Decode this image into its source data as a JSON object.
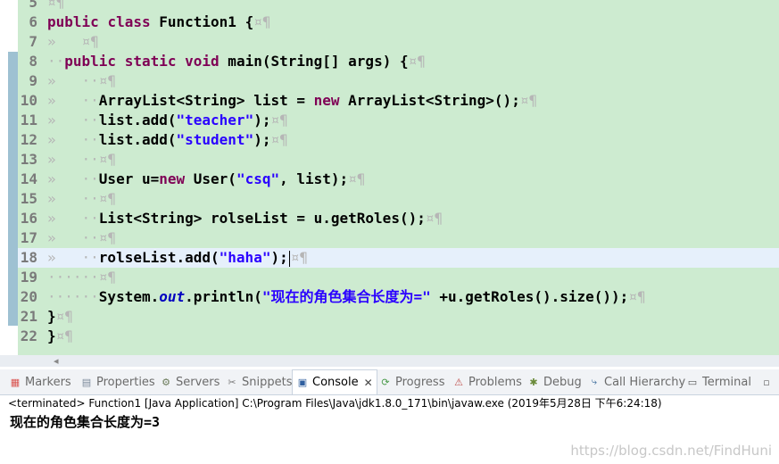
{
  "editor": {
    "lines": [
      {
        "num": "5",
        "segments": [
          {
            "t": "¤¶",
            "c": "ws"
          }
        ]
      },
      {
        "num": "6",
        "segments": [
          {
            "t": "public",
            "c": "kw"
          },
          {
            "t": " "
          },
          {
            "t": "class",
            "c": "kw"
          },
          {
            "t": " Function1 {"
          },
          {
            "t": "¤¶",
            "c": "ws"
          }
        ]
      },
      {
        "num": "7",
        "segments": [
          {
            "t": "»   ",
            "c": "ws"
          },
          {
            "t": "¤¶",
            "c": "ws"
          }
        ]
      },
      {
        "num": "8",
        "segments": [
          {
            "t": "··",
            "c": "ws"
          },
          {
            "t": "public",
            "c": "kw"
          },
          {
            "t": " "
          },
          {
            "t": "static",
            "c": "kw"
          },
          {
            "t": " "
          },
          {
            "t": "void",
            "c": "kw"
          },
          {
            "t": " main(String[] args) {"
          },
          {
            "t": "¤¶",
            "c": "ws"
          }
        ]
      },
      {
        "num": "9",
        "segments": [
          {
            "t": "»   ··",
            "c": "ws"
          },
          {
            "t": "¤¶",
            "c": "ws"
          }
        ]
      },
      {
        "num": "10",
        "segments": [
          {
            "t": "»   ··",
            "c": "ws"
          },
          {
            "t": "ArrayList<String> list = "
          },
          {
            "t": "new",
            "c": "kw"
          },
          {
            "t": " ArrayList<String>();"
          },
          {
            "t": "¤¶",
            "c": "ws"
          }
        ]
      },
      {
        "num": "11",
        "segments": [
          {
            "t": "»   ··",
            "c": "ws"
          },
          {
            "t": "list.add("
          },
          {
            "t": "\"teacher\"",
            "c": "str"
          },
          {
            "t": ");"
          },
          {
            "t": "¤¶",
            "c": "ws"
          }
        ]
      },
      {
        "num": "12",
        "segments": [
          {
            "t": "»   ··",
            "c": "ws"
          },
          {
            "t": "list.add("
          },
          {
            "t": "\"student\"",
            "c": "str"
          },
          {
            "t": ");"
          },
          {
            "t": "¤¶",
            "c": "ws"
          }
        ]
      },
      {
        "num": "13",
        "segments": [
          {
            "t": "»   ··",
            "c": "ws"
          },
          {
            "t": "¤¶",
            "c": "ws"
          }
        ]
      },
      {
        "num": "14",
        "segments": [
          {
            "t": "»   ··",
            "c": "ws"
          },
          {
            "t": "User u="
          },
          {
            "t": "new",
            "c": "kw"
          },
          {
            "t": " User("
          },
          {
            "t": "\"csq\"",
            "c": "str"
          },
          {
            "t": ", list);"
          },
          {
            "t": "¤¶",
            "c": "ws"
          }
        ]
      },
      {
        "num": "15",
        "segments": [
          {
            "t": "»   ··",
            "c": "ws"
          },
          {
            "t": "¤¶",
            "c": "ws"
          }
        ]
      },
      {
        "num": "16",
        "segments": [
          {
            "t": "»   ··",
            "c": "ws"
          },
          {
            "t": "List<String> rolseList = u.getRoles();"
          },
          {
            "t": "¤¶",
            "c": "ws"
          }
        ]
      },
      {
        "num": "17",
        "segments": [
          {
            "t": "»   ··",
            "c": "ws"
          },
          {
            "t": "¤¶",
            "c": "ws"
          }
        ]
      },
      {
        "num": "18",
        "current": true,
        "segments": [
          {
            "t": "»   ··",
            "c": "ws"
          },
          {
            "t": "rolseList.add("
          },
          {
            "t": "\"haha\"",
            "c": "str"
          },
          {
            "t": ");"
          },
          {
            "t": "|",
            "c": "caret"
          },
          {
            "t": "¤¶",
            "c": "ws"
          }
        ]
      },
      {
        "num": "19",
        "segments": [
          {
            "t": "······",
            "c": "ws"
          },
          {
            "t": "¤¶",
            "c": "ws"
          }
        ]
      },
      {
        "num": "20",
        "segments": [
          {
            "t": "······",
            "c": "ws"
          },
          {
            "t": "System."
          },
          {
            "t": "out",
            "c": "fld"
          },
          {
            "t": ".println("
          },
          {
            "t": "\"现在的角色集合长度为=\"",
            "c": "str"
          },
          {
            "t": " +u.getRoles().size());"
          },
          {
            "t": "¤¶",
            "c": "ws"
          }
        ]
      },
      {
        "num": "21",
        "segments": [
          {
            "t": "}"
          },
          {
            "t": "¤¶",
            "c": "ws"
          }
        ]
      },
      {
        "num": "22",
        "segments": [
          {
            "t": "}"
          },
          {
            "t": "¤¶",
            "c": "ws"
          }
        ]
      }
    ]
  },
  "tabs": [
    {
      "name": "tab-markers",
      "label": "Markers",
      "icon": "markers-icon",
      "glyph": "▦",
      "color": "#d9534f"
    },
    {
      "name": "tab-properties",
      "label": "Properties",
      "icon": "properties-icon",
      "glyph": "▤",
      "color": "#7a8a9a"
    },
    {
      "name": "tab-servers",
      "label": "Servers",
      "icon": "servers-icon",
      "glyph": "⚙",
      "color": "#6b7b5a"
    },
    {
      "name": "tab-snippets",
      "label": "Snippets",
      "icon": "snippets-icon",
      "glyph": "✂",
      "color": "#7a7a7a"
    },
    {
      "name": "tab-console",
      "label": "Console",
      "icon": "console-icon",
      "glyph": "▣",
      "color": "#2f5f9f",
      "active": true
    },
    {
      "name": "tab-progress",
      "label": "Progress",
      "icon": "progress-icon",
      "glyph": "⟳",
      "color": "#4a9a4a"
    },
    {
      "name": "tab-problems",
      "label": "Problems",
      "icon": "problems-icon",
      "glyph": "⚠",
      "color": "#c0504d"
    },
    {
      "name": "tab-debug",
      "label": "Debug",
      "icon": "debug-icon",
      "glyph": "✱",
      "color": "#6a8a3a"
    },
    {
      "name": "tab-call-hierarchy",
      "label": "Call Hierarchy",
      "icon": "call-hierarchy-icon",
      "glyph": "⤷",
      "color": "#3a6a9a"
    },
    {
      "name": "tab-terminal",
      "label": "Terminal",
      "icon": "terminal-icon",
      "glyph": "▭",
      "color": "#555555"
    }
  ],
  "console": {
    "close_glyph": "✕",
    "header": "<terminated> Function1 [Java Application] C:\\Program Files\\Java\\jdk1.8.0_171\\bin\\javaw.exe (2019年5月28日 下午6:24:18)",
    "output": "现在的角色集合长度为=3",
    "minimize_glyph": "▫"
  },
  "watermark": "https://blog.csdn.net/FindHuni"
}
